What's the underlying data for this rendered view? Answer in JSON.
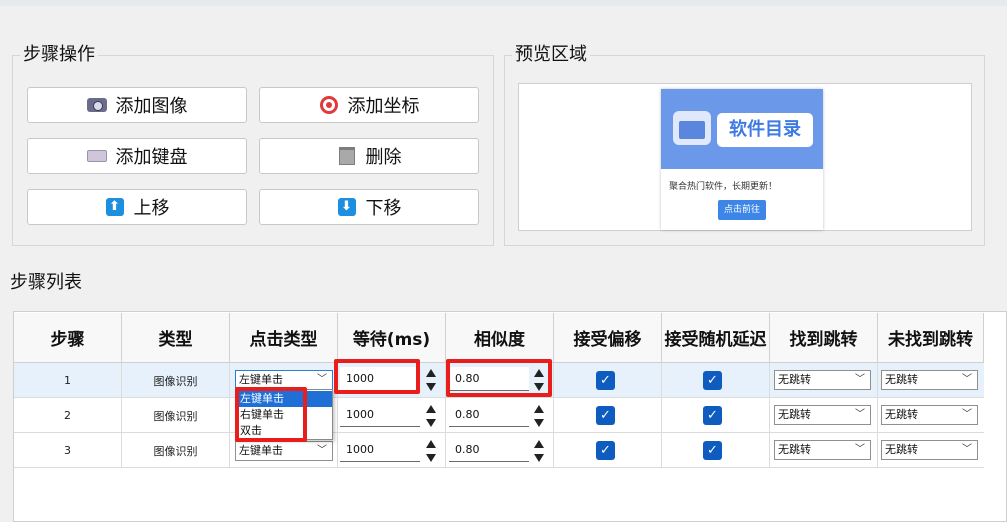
{
  "step_ops": {
    "title": "步骤操作",
    "buttons": [
      {
        "label": "添加图像",
        "icon": "camera-icon"
      },
      {
        "label": "添加坐标",
        "icon": "target-icon"
      },
      {
        "label": "添加键盘",
        "icon": "keyboard-icon"
      },
      {
        "label": "删除",
        "icon": "trash-icon"
      },
      {
        "label": "上移",
        "icon": "arrow-up-icon",
        "glyph": "⬆"
      },
      {
        "label": "下移",
        "icon": "arrow-down-icon",
        "glyph": "⬇"
      }
    ]
  },
  "preview": {
    "title": "预览区域",
    "card_title": "软件目录",
    "card_subtitle": "聚合热门软件，长期更新！",
    "card_button": "点击前往"
  },
  "steps": {
    "title": "步骤列表",
    "columns": [
      "步骤",
      "类型",
      "点击类型",
      "等待(ms)",
      "相似度",
      "接受偏移",
      "接受随机延迟",
      "找到跳转",
      "未找到跳转"
    ],
    "rows": [
      {
        "step": "1",
        "type": "图像识别",
        "click_type": "左键单击",
        "wait": "1000",
        "similarity": "0.80",
        "accept_offset": true,
        "accept_random_delay": true,
        "on_found": "无跳转",
        "on_not_found": "无跳转"
      },
      {
        "step": "2",
        "type": "图像识别",
        "click_type": "左键单击",
        "wait": "1000",
        "similarity": "0.80",
        "accept_offset": true,
        "accept_random_delay": true,
        "on_found": "无跳转",
        "on_not_found": "无跳转"
      },
      {
        "step": "3",
        "type": "图像识别",
        "click_type": "左键单击",
        "wait": "1000",
        "similarity": "0.80",
        "accept_offset": true,
        "accept_random_delay": true,
        "on_found": "无跳转",
        "on_not_found": "无跳转"
      }
    ],
    "click_type_options": [
      "左键单击",
      "右键单击",
      "双击"
    ],
    "highlighted_option": "左键单击"
  },
  "colors": {
    "accent": "#1f6fd6",
    "checkbox": "#0f5cc0",
    "annotation_red": "#ea1d1d",
    "preview_header": "#6c98e9"
  }
}
